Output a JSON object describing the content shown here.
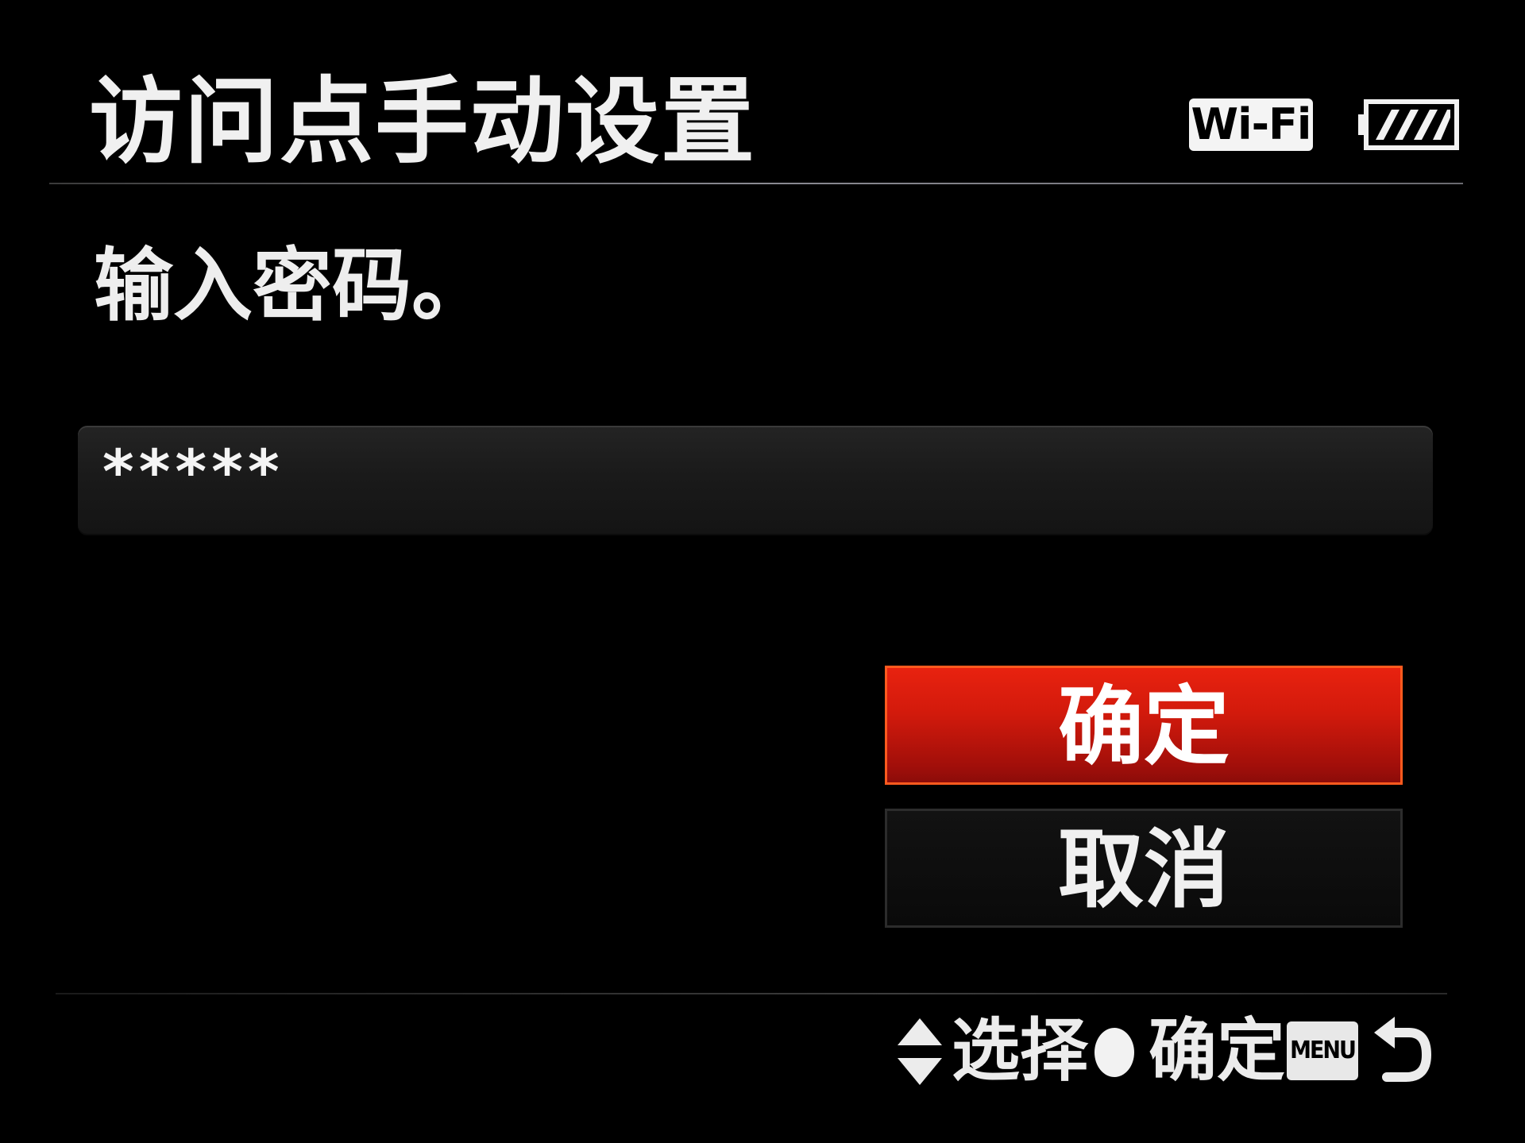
{
  "header": {
    "title": "访问点手动设置",
    "wifi_label": "Wi-Fi",
    "battery_icon": "battery-full-icon"
  },
  "prompt": "输入密码。",
  "password_field": {
    "value": "*****"
  },
  "buttons": {
    "ok_label": "确定",
    "cancel_label": "取消"
  },
  "footer": {
    "select_icon": "up-down-arrow-icon",
    "select_label": "选择",
    "confirm_icon": "center-button-icon",
    "confirm_label": "确定",
    "menu_label": "MENU",
    "back_icon": "return-arrow-icon"
  },
  "colors": {
    "background": "#000000",
    "accent_red": "#d21a0c",
    "text": "#f0f0f0"
  }
}
